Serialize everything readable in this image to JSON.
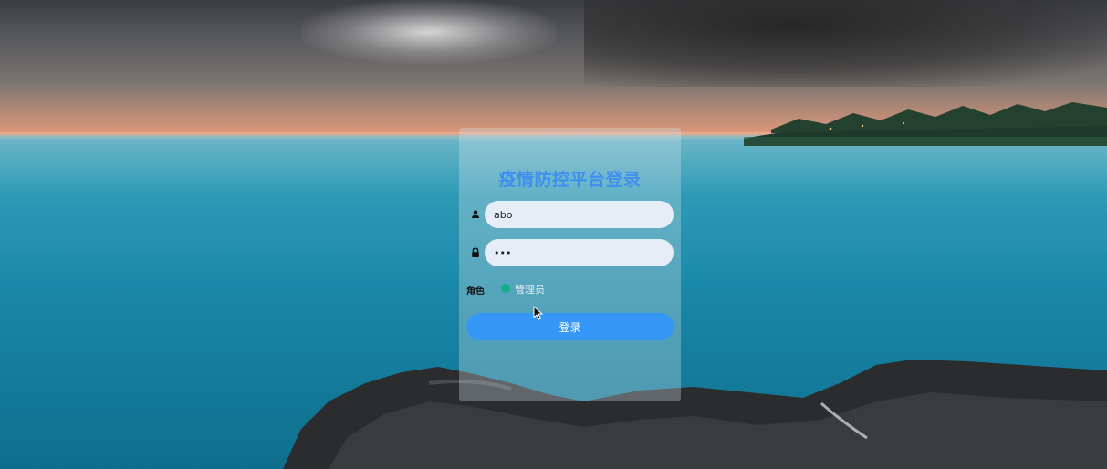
{
  "login": {
    "title": "疫情防控平台登录",
    "username_value": "abo",
    "password_value": "•••",
    "role_label": "角色",
    "role_option": "管理员",
    "submit_label": "登录"
  },
  "icons": {
    "username": "user-icon",
    "password": "lock-icon",
    "pointer": "mouse-cursor-icon"
  },
  "colors": {
    "title": "#3f8ff0",
    "button": "#3597f5",
    "radio": "#0fae8c",
    "input_bg": "#e6edf6"
  }
}
